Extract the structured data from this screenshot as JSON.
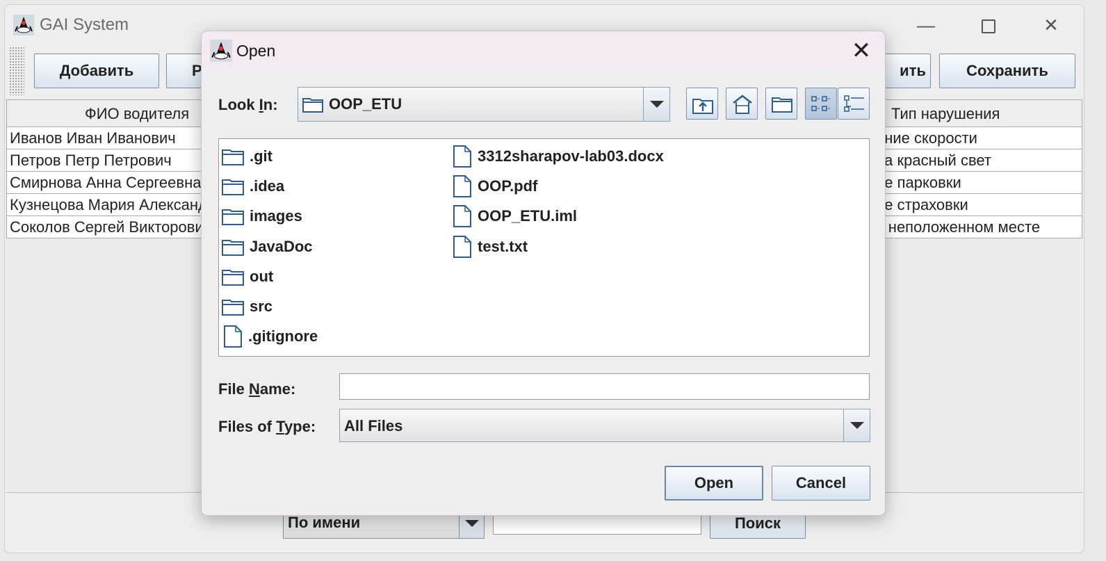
{
  "main_window": {
    "title": "GAI System",
    "toolbar": {
      "add_label": "Добавить",
      "edit_partial_label": "Р",
      "delete_partial_label": "ить",
      "save_label": "Сохранить"
    },
    "table": {
      "columns": [
        "ФИО водителя",
        "Тип нарушения"
      ],
      "rows": [
        {
          "driver": "Иванов Иван Иванович",
          "violation": "ение скорости"
        },
        {
          "driver": "Петров Петр Петрович",
          "violation": "на красный свет"
        },
        {
          "driver": "Смирнова Анна Сергеевна",
          "violation": "ие парковки"
        },
        {
          "driver": "Кузнецова Мария Александровна",
          "violation": "ие страховки"
        },
        {
          "driver": "Соколов Сергей Викторович",
          "violation": "в неположенном месте"
        }
      ]
    },
    "search": {
      "mode_value": "По имени",
      "query_value": "",
      "button_label": "Поиск"
    }
  },
  "dialog": {
    "title": "Open",
    "look_in": {
      "label_pre": "Look ",
      "label_mnemonic": "I",
      "label_post": "n:",
      "value": "OOP_ETU"
    },
    "files": [
      {
        "name": ".git",
        "kind": "folder"
      },
      {
        "name": ".idea",
        "kind": "folder"
      },
      {
        "name": "images",
        "kind": "folder"
      },
      {
        "name": "JavaDoc",
        "kind": "folder"
      },
      {
        "name": "out",
        "kind": "folder"
      },
      {
        "name": "src",
        "kind": "folder"
      },
      {
        "name": ".gitignore",
        "kind": "file"
      },
      {
        "name": "3312sharapov-lab03.docx",
        "kind": "file"
      },
      {
        "name": "OOP.pdf",
        "kind": "file"
      },
      {
        "name": "OOP_ETU.iml",
        "kind": "file"
      },
      {
        "name": "test.txt",
        "kind": "file"
      }
    ],
    "file_name": {
      "label_pre": "File ",
      "label_mnemonic": "N",
      "label_post": "ame:",
      "value": ""
    },
    "file_type": {
      "label_pre": "Files of ",
      "label_mnemonic": "T",
      "label_post": "ype:",
      "value": "All Files"
    },
    "open_label": "Open",
    "cancel_label": "Cancel"
  },
  "icons": {
    "app": "java-duke-icon",
    "folder": "folder-icon",
    "file": "file-icon",
    "up_folder": "up-one-level-icon",
    "home": "home-icon",
    "new_folder": "new-folder-icon",
    "list_view": "list-view-icon",
    "details_view": "details-view-icon"
  },
  "colors": {
    "dialog_titlebar": "#f4ebf2",
    "button_border": "#7b8fa6",
    "icon_blue": "#2c5d8e"
  }
}
